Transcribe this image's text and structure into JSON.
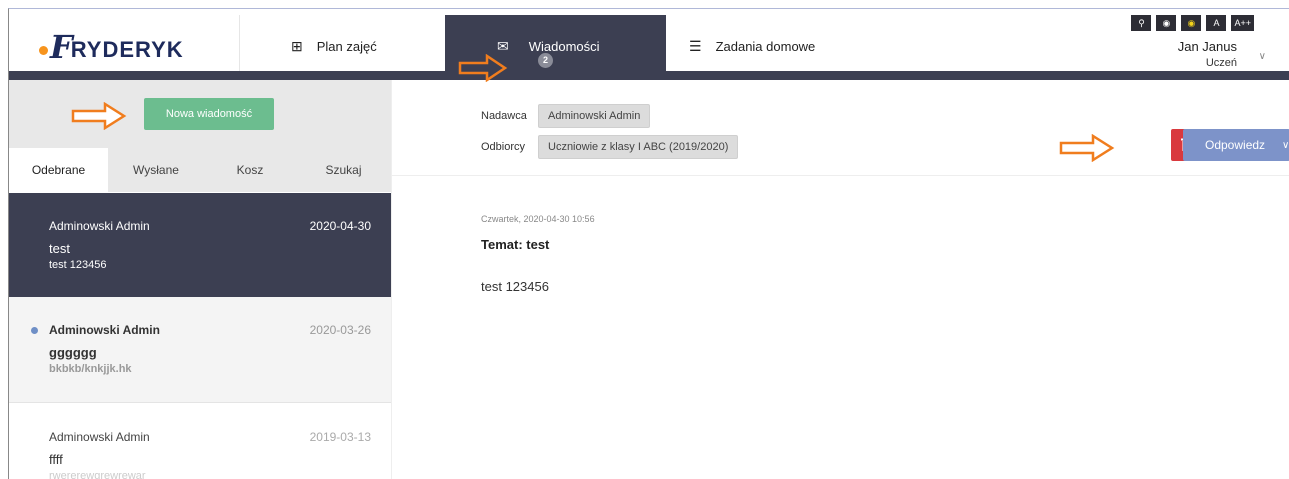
{
  "brand": {
    "logo_first": "F",
    "logo_rest": "RYDERYK"
  },
  "nav": {
    "plan_label": "Plan zajęć",
    "messages_label": "Wiadomości",
    "messages_badge": "2",
    "homework_label": "Zadania domowe"
  },
  "accessibility": [
    "⚲",
    "◉",
    "◉",
    "A",
    "A++"
  ],
  "user": {
    "name": "Jan Janus",
    "role": "Uczeń"
  },
  "left": {
    "new_message_label": "Nowa wiadomość",
    "tabs": [
      "Odebrane",
      "Wysłane",
      "Kosz",
      "Szukaj"
    ]
  },
  "messages": [
    {
      "from": "Adminowski Admin",
      "date": "2020-04-30",
      "subject": "test",
      "preview": "test 123456"
    },
    {
      "from": "Adminowski Admin",
      "date": "2020-03-26",
      "subject": "gggggg",
      "preview": "bkbkb/knkjjk.hk"
    },
    {
      "from": "Adminowski Admin",
      "date": "2019-03-13",
      "subject": "ffff",
      "preview": "rwererewgrewrewar"
    }
  ],
  "detail": {
    "sender_label": "Nadawca",
    "sender_value": "Adminowski Admin",
    "recipients_label": "Odbiorcy",
    "recipients_value": "Uczniowie z klasy I ABC (2019/2020)",
    "reply_label": "Odpowiedz",
    "datetime": "Czwartek, 2020-04-30 10:56",
    "topic": "Temat: test",
    "body": "test 123456"
  },
  "colors": {
    "dark_nav": "#3c3f52",
    "new_button": "#6cbd8f",
    "delete_button": "#d9393e",
    "reply_button": "#7d93c9",
    "annotation_arrow": "#f07d1e"
  }
}
